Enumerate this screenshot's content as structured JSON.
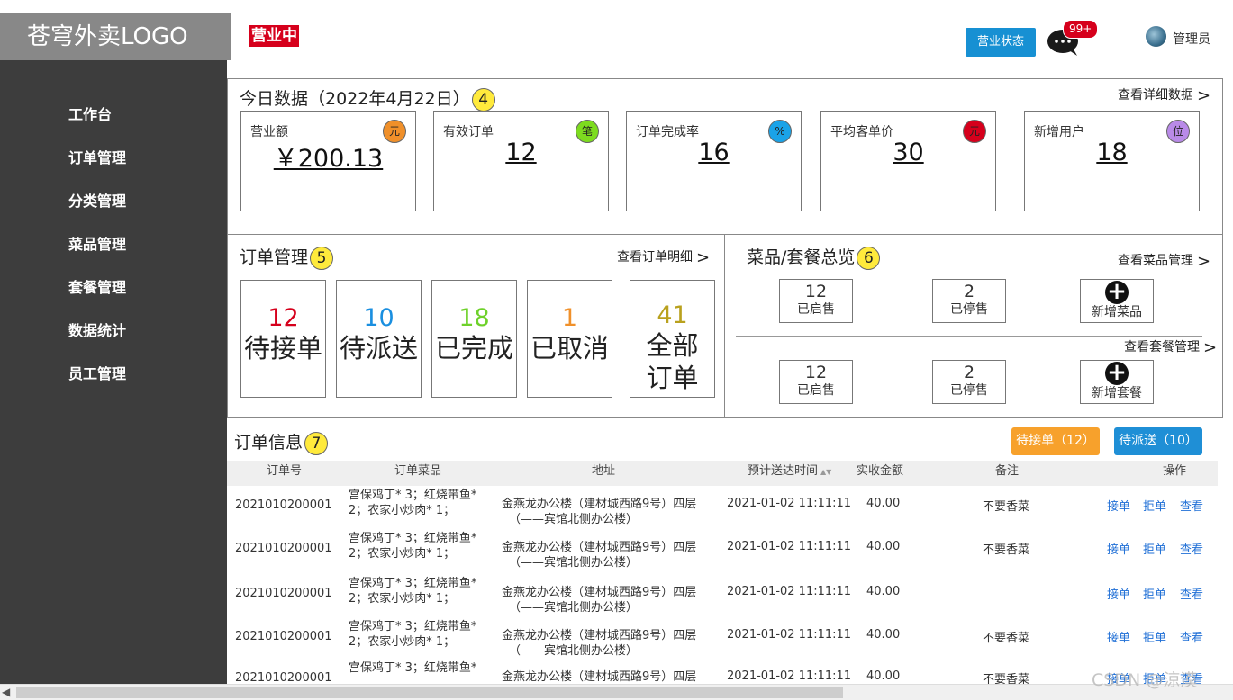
{
  "app": {
    "logo": "苍穹外卖LOGO",
    "status_tag": "营业中",
    "business_status_button": "营业状态",
    "message_badge": "99+",
    "admin_name": "管理员"
  },
  "sidebar": {
    "items": [
      {
        "label": "工作台"
      },
      {
        "label": "订单管理"
      },
      {
        "label": "分类管理"
      },
      {
        "label": "菜品管理"
      },
      {
        "label": "套餐管理"
      },
      {
        "label": "数据统计"
      },
      {
        "label": "员工管理"
      }
    ]
  },
  "today": {
    "title": "今日数据（2022年4月22日）",
    "marker": "4",
    "detail_link": "查看详细数据",
    "cards": [
      {
        "label": "营业额",
        "icon_text": "元",
        "icon_color": "#f0902a",
        "value": "￥200.13"
      },
      {
        "label": "有效订单",
        "icon_text": "笔",
        "icon_color": "#7ddc1f",
        "value": "12"
      },
      {
        "label": "订单完成率",
        "icon_text": "%",
        "icon_color": "#1aa3e8",
        "value": "16"
      },
      {
        "label": "平均客单价",
        "icon_text": "元",
        "icon_color": "#d6001c",
        "value": "30"
      },
      {
        "label": "新增用户",
        "icon_text": "位",
        "icon_color": "#b98ae8",
        "value": "18"
      }
    ]
  },
  "orders_overview": {
    "title": "订单管理",
    "marker": "5",
    "detail_link": "查看订单明细",
    "cards": [
      {
        "count": "12",
        "label": "待接单",
        "color": "#d6001c"
      },
      {
        "count": "10",
        "label": "待派送",
        "color": "#1a8fe0"
      },
      {
        "count": "18",
        "label": "已完成",
        "color": "#6ed12a"
      },
      {
        "count": "1",
        "label": "已取消",
        "color": "#f0902a"
      },
      {
        "count": "41",
        "label_line1": "全部",
        "label_line2": "订单",
        "color": "#b9a11e"
      }
    ]
  },
  "dish_overview": {
    "title": "菜品/套餐总览",
    "marker": "6",
    "dish_link": "查看菜品管理",
    "setmeal_link": "查看套餐管理",
    "dish": {
      "enabled_count": "12",
      "enabled_label": "已启售",
      "disabled_count": "2",
      "disabled_label": "已停售",
      "add_label": "新增菜品"
    },
    "setmeal": {
      "enabled_count": "12",
      "enabled_label": "已启售",
      "disabled_count": "2",
      "disabled_label": "已停售",
      "add_label": "新增套餐"
    }
  },
  "order_info": {
    "title": "订单信息",
    "marker": "7",
    "pending_button": "待接单（12）",
    "delivering_button": "待派送（10）",
    "columns": [
      "订单号",
      "订单菜品",
      "地址",
      "预计送达时间",
      "实收金额",
      "备注",
      "操作"
    ],
    "rows": [
      {
        "no": "2021010200001",
        "dishes_1": "宫保鸡丁* 3；红烧带鱼*",
        "dishes_2": "2；农家小炒肉* 1；",
        "addr_1": "金燕龙办公楼（建材城西路9号）四层",
        "addr_2": "（——宾馆北侧办公楼）",
        "time": "2021-01-02 11:11:11",
        "amount": "40.00",
        "note": "不要香菜"
      },
      {
        "no": "2021010200001",
        "dishes_1": "宫保鸡丁* 3；红烧带鱼*",
        "dishes_2": "2；农家小炒肉* 1；",
        "addr_1": "金燕龙办公楼（建材城西路9号）四层",
        "addr_2": "（——宾馆北侧办公楼）",
        "time": "2021-01-02 11:11:11",
        "amount": "40.00",
        "note": "不要香菜"
      },
      {
        "no": "2021010200001",
        "dishes_1": "宫保鸡丁* 3；红烧带鱼*",
        "dishes_2": "2；农家小炒肉* 1；",
        "addr_1": "金燕龙办公楼（建材城西路9号）四层",
        "addr_2": "（——宾馆北侧办公楼）",
        "time": "2021-01-02 11:11:11",
        "amount": "40.00",
        "note": ""
      },
      {
        "no": "2021010200001",
        "dishes_1": "宫保鸡丁* 3；红烧带鱼*",
        "dishes_2": "2；农家小炒肉* 1；",
        "addr_1": "金燕龙办公楼（建材城西路9号）四层",
        "addr_2": "（——宾馆北侧办公楼）",
        "time": "2021-01-02 11:11:11",
        "amount": "40.00",
        "note": "不要香菜"
      },
      {
        "no": "2021010200001",
        "dishes_1": "宫保鸡丁* 3；红烧带鱼*",
        "dishes_2": "",
        "addr_1": "金燕龙办公楼（建材城西路9号）四层",
        "addr_2": "",
        "time": "2021-01-02 11:11:11",
        "amount": "40.00",
        "note": "不要香菜"
      }
    ],
    "actions": {
      "accept": "接单",
      "reject": "拒单",
      "view": "查看"
    }
  },
  "watermark": "CSDN @涼漠"
}
